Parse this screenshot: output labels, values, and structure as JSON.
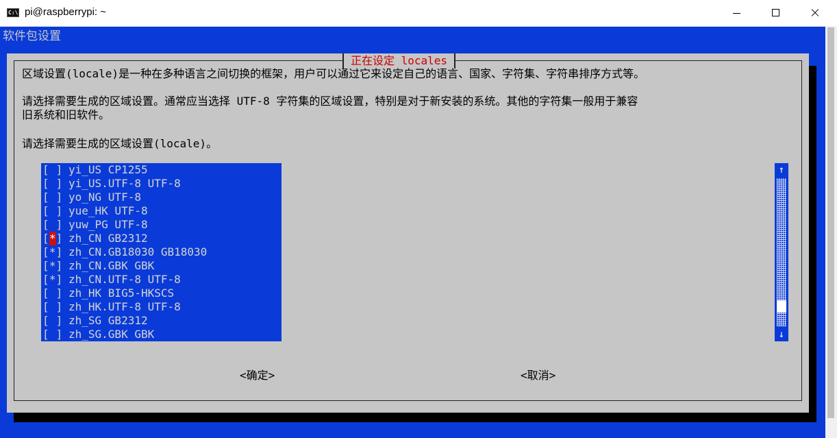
{
  "window": {
    "icon_text": "C:\\",
    "title": "pi@raspberrypi: ~"
  },
  "backtitle": "软件包设置",
  "dialog": {
    "title": "正在设定 locales",
    "desc_line1": "区域设置(locale)是一种在多种语言之间切换的框架，用户可以通过它来设定自己的语言、国家、字符集、字符串排序方式等。",
    "desc_line2": "请选择需要生成的区域设置。通常应当选择 UTF-8 字符集的区域设置，特别是对于新安装的系统。其他的字符集一般用于兼容",
    "desc_line3": "旧系统和旧软件。",
    "prompt": "请选择需要生成的区域设置(locale)。",
    "ok_label": "<确定>",
    "cancel_label": "<取消>",
    "scroll_up": "↑",
    "scroll_down": "↓"
  },
  "locales": [
    {
      "checked": false,
      "cursor": false,
      "name": "yi_US CP1255"
    },
    {
      "checked": false,
      "cursor": false,
      "name": "yi_US.UTF-8 UTF-8"
    },
    {
      "checked": false,
      "cursor": false,
      "name": "yo_NG UTF-8"
    },
    {
      "checked": false,
      "cursor": false,
      "name": "yue_HK UTF-8"
    },
    {
      "checked": false,
      "cursor": false,
      "name": "yuw_PG UTF-8"
    },
    {
      "checked": true,
      "cursor": true,
      "name": "zh_CN GB2312"
    },
    {
      "checked": true,
      "cursor": false,
      "name": "zh_CN.GB18030 GB18030"
    },
    {
      "checked": true,
      "cursor": false,
      "name": "zh_CN.GBK GBK"
    },
    {
      "checked": true,
      "cursor": false,
      "name": "zh_CN.UTF-8 UTF-8"
    },
    {
      "checked": false,
      "cursor": false,
      "name": "zh_HK BIG5-HKSCS"
    },
    {
      "checked": false,
      "cursor": false,
      "name": "zh_HK.UTF-8 UTF-8"
    },
    {
      "checked": false,
      "cursor": false,
      "name": "zh_SG GB2312"
    },
    {
      "checked": false,
      "cursor": false,
      "name": "zh_SG.GBK GBK"
    }
  ],
  "colors": {
    "terminal_blue": "#0a3bd8",
    "dialog_gray": "#c6c6c6",
    "title_red": "#cc0000",
    "cursor_red": "#cc1111"
  }
}
